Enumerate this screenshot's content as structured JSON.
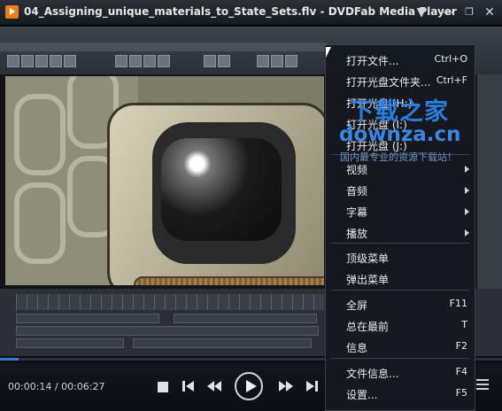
{
  "window": {
    "title": "04_Assigning_unique_materials_to_State_Sets.flv - DVDFab Media Player",
    "buttons": [
      "minimize",
      "restore",
      "close"
    ]
  },
  "player": {
    "current_time": "00:00:14",
    "separator": " / ",
    "total_time": "00:06:27",
    "progress_fraction": 0.037,
    "controls": [
      "stop-icon",
      "previous-icon",
      "rewind-icon",
      "play-icon",
      "fast-forward-icon",
      "next-icon",
      "menu-icon"
    ]
  },
  "context_menu": {
    "items": [
      {
        "label": "打开文件...",
        "shortcut": "Ctrl+O"
      },
      {
        "label": "打开光盘文件夹...",
        "shortcut": "Ctrl+F"
      },
      {
        "label": "打开光盘 (H:)",
        "shortcut": ""
      },
      {
        "label": "打开光盘 (I:)",
        "shortcut": ""
      },
      {
        "label": "打开光盘 (J:)",
        "shortcut": ""
      },
      {
        "label": "视频",
        "submenu": true
      },
      {
        "label": "音频",
        "submenu": true
      },
      {
        "label": "字幕",
        "submenu": true
      },
      {
        "label": "播放",
        "submenu": true
      },
      {
        "label": "顶级菜单",
        "shortcut": ""
      },
      {
        "label": "弹出菜单",
        "shortcut": ""
      },
      {
        "label": "全屏",
        "shortcut": "F11"
      },
      {
        "label": "总在最前",
        "shortcut": "T"
      },
      {
        "label": "信息",
        "shortcut": "F2"
      },
      {
        "label": "文件信息...",
        "shortcut": "F4"
      },
      {
        "label": "设置...",
        "shortcut": "F5"
      }
    ]
  },
  "watermark": {
    "line1": "下载之家",
    "line2": "downza.cn",
    "line3": "国内最专业的资源下载站！"
  },
  "colors": {
    "accent": "#3a7bd5",
    "title_icon": "#e8801a",
    "menu_bg": "#161a20"
  }
}
